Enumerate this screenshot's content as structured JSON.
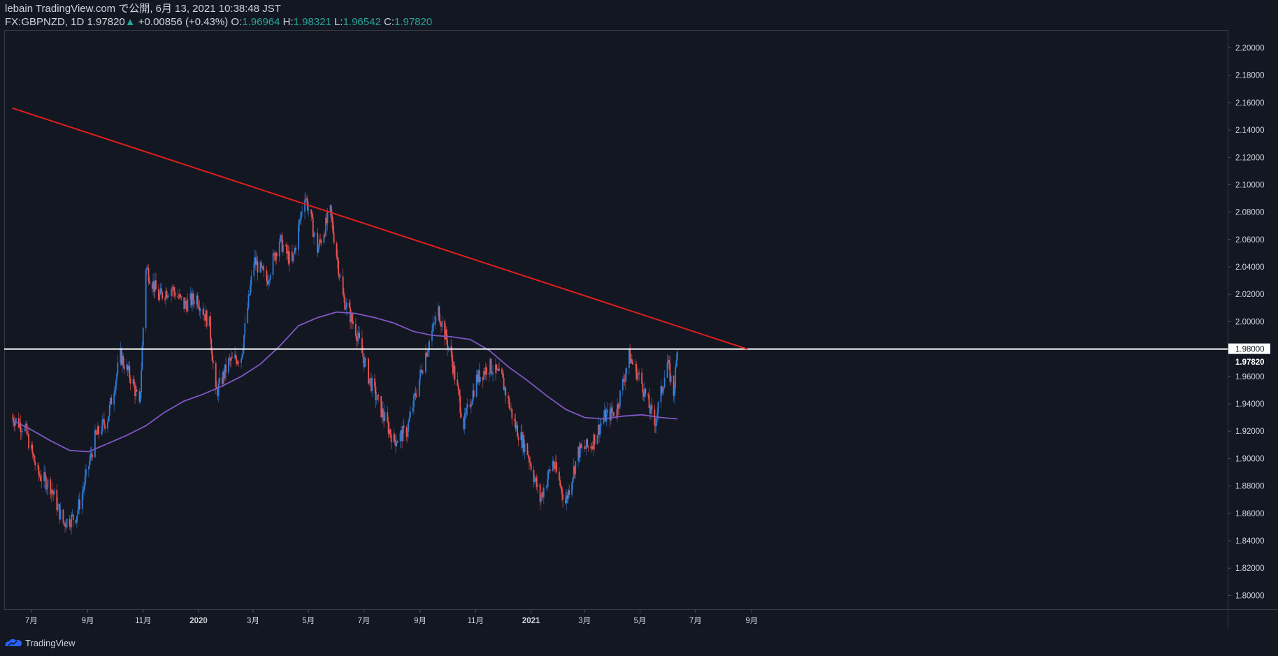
{
  "header": {
    "line1": "lebain TradingView.com で公開, 6月 13, 2021 10:38:48 JST",
    "symbol": "FX:GBPNZD, 1D",
    "last": "1.97820",
    "change": "+0.00856 (+0.43%)",
    "o_label": "O:",
    "o_value": "1.96964",
    "h_label": "H:",
    "h_value": "1.98321",
    "l_label": "L:",
    "l_value": "1.96542",
    "c_label": "C:",
    "c_value": "1.97820"
  },
  "footer": {
    "brand": "TradingView"
  },
  "colors": {
    "background": "#131722",
    "up": "#2e7bd3",
    "down": "#ef5350",
    "ma": "#7e57c2",
    "trendline": "#e01e1e",
    "horizontal_line": "#ffffff",
    "axis_text": "#d1d4dc"
  },
  "chart_data": {
    "type": "candlestick",
    "symbol": "FX:GBPNZD",
    "interval": "1D",
    "x_tick_labels": [
      "7月",
      "9月",
      "11月",
      "2020",
      "3月",
      "5月",
      "7月",
      "9月",
      "11月",
      "2021",
      "3月",
      "5月",
      "7月",
      "9月"
    ],
    "y_tick_labels": [
      "2.20000",
      "2.18000",
      "2.16000",
      "2.14000",
      "2.12000",
      "2.10000",
      "2.08000",
      "2.06000",
      "2.04000",
      "2.02000",
      "2.00000",
      "1.98000",
      "1.96000",
      "1.94000",
      "1.92000",
      "1.90000",
      "1.88000",
      "1.86000",
      "1.84000",
      "1.82000",
      "1.80000"
    ],
    "ylim": [
      1.79,
      2.213
    ],
    "last_price_label": "1.97820",
    "horizontal_line_label": "1.98000",
    "horizontal_line": 1.98,
    "trendline": {
      "start": [
        "2019-06-10",
        2.156
      ],
      "end": [
        "2021-08-27",
        1.98
      ]
    },
    "moving_average": [
      [
        "2019-06-10",
        1.928
      ],
      [
        "2019-07-01",
        1.921
      ],
      [
        "2019-07-22",
        1.913
      ],
      [
        "2019-08-12",
        1.906
      ],
      [
        "2019-09-02",
        1.905
      ],
      [
        "2019-09-23",
        1.911
      ],
      [
        "2019-10-14",
        1.917
      ],
      [
        "2019-11-04",
        1.924
      ],
      [
        "2019-11-25",
        1.934
      ],
      [
        "2019-12-16",
        1.942
      ],
      [
        "2020-01-06",
        1.947
      ],
      [
        "2020-01-27",
        1.953
      ],
      [
        "2020-02-17",
        1.96
      ],
      [
        "2020-03-09",
        1.969
      ],
      [
        "2020-03-30",
        1.982
      ],
      [
        "2020-04-20",
        1.997
      ],
      [
        "2020-05-11",
        2.003
      ],
      [
        "2020-06-01",
        2.007
      ],
      [
        "2020-06-22",
        2.006
      ],
      [
        "2020-07-13",
        2.003
      ],
      [
        "2020-08-03",
        1.999
      ],
      [
        "2020-08-24",
        1.993
      ],
      [
        "2020-09-14",
        1.99
      ],
      [
        "2020-10-05",
        1.989
      ],
      [
        "2020-10-26",
        1.987
      ],
      [
        "2020-11-16",
        1.979
      ],
      [
        "2020-12-07",
        1.967
      ],
      [
        "2020-12-28",
        1.957
      ],
      [
        "2021-01-18",
        1.946
      ],
      [
        "2021-02-08",
        1.936
      ],
      [
        "2021-03-01",
        1.93
      ],
      [
        "2021-03-22",
        1.929
      ],
      [
        "2021-04-12",
        1.931
      ],
      [
        "2021-05-03",
        1.932
      ],
      [
        "2021-05-24",
        1.93
      ],
      [
        "2021-06-11",
        1.929
      ]
    ],
    "ohlc_path": [
      [
        "2019-06-10",
        1.93
      ],
      [
        "2019-06-24",
        1.922
      ],
      [
        "2019-07-08",
        1.889
      ],
      [
        "2019-07-22",
        1.88
      ],
      [
        "2019-08-05",
        1.853
      ],
      [
        "2019-08-19",
        1.858
      ],
      [
        "2019-08-26",
        1.875
      ],
      [
        "2019-09-09",
        1.915
      ],
      [
        "2019-09-23",
        1.93
      ],
      [
        "2019-10-07",
        1.975
      ],
      [
        "2019-10-21",
        1.955
      ],
      [
        "2019-10-28",
        1.937
      ],
      [
        "2019-11-04",
        2.04
      ],
      [
        "2019-11-18",
        2.018
      ],
      [
        "2019-12-02",
        2.025
      ],
      [
        "2019-12-16",
        2.012
      ],
      [
        "2019-12-30",
        2.018
      ],
      [
        "2020-01-13",
        1.998
      ],
      [
        "2020-01-20",
        1.947
      ],
      [
        "2020-02-03",
        1.97
      ],
      [
        "2020-02-17",
        1.975
      ],
      [
        "2020-03-02",
        2.045
      ],
      [
        "2020-03-16",
        2.03
      ],
      [
        "2020-03-30",
        2.06
      ],
      [
        "2020-04-13",
        2.042
      ],
      [
        "2020-04-27",
        2.094
      ],
      [
        "2020-05-11",
        2.053
      ],
      [
        "2020-05-25",
        2.08
      ],
      [
        "2020-06-08",
        2.018
      ],
      [
        "2020-06-22",
        1.994
      ],
      [
        "2020-07-06",
        1.96
      ],
      [
        "2020-07-20",
        1.935
      ],
      [
        "2020-08-03",
        1.913
      ],
      [
        "2020-08-17",
        1.92
      ],
      [
        "2020-09-07",
        1.977
      ],
      [
        "2020-09-21",
        2.008
      ],
      [
        "2020-10-05",
        1.975
      ],
      [
        "2020-10-19",
        1.925
      ],
      [
        "2020-11-02",
        1.958
      ],
      [
        "2020-11-16",
        1.968
      ],
      [
        "2020-11-30",
        1.958
      ],
      [
        "2020-12-14",
        1.925
      ],
      [
        "2020-12-28",
        1.905
      ],
      [
        "2021-01-11",
        1.87
      ],
      [
        "2021-01-25",
        1.898
      ],
      [
        "2021-02-08",
        1.868
      ],
      [
        "2021-02-22",
        1.905
      ],
      [
        "2021-03-08",
        1.91
      ],
      [
        "2021-03-22",
        1.93
      ],
      [
        "2021-04-05",
        1.935
      ],
      [
        "2021-04-19",
        1.975
      ],
      [
        "2021-05-03",
        1.955
      ],
      [
        "2021-05-17",
        1.925
      ],
      [
        "2021-05-31",
        1.97
      ],
      [
        "2021-06-07",
        1.948
      ],
      [
        "2021-06-11",
        1.978
      ]
    ]
  }
}
